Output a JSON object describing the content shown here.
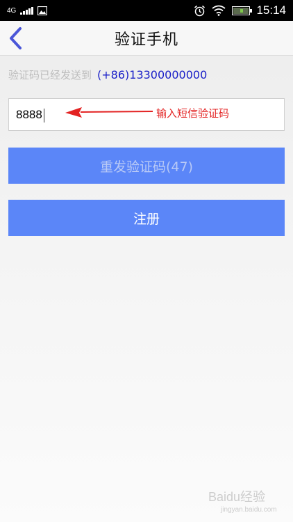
{
  "status_bar": {
    "network": "4G",
    "time": "15:14",
    "icons": [
      "signal-icon",
      "image-icon",
      "alarm-icon",
      "wifi-icon",
      "battery-icon"
    ]
  },
  "header": {
    "title": "验证手机",
    "back_icon": "chevron-left-icon"
  },
  "info": {
    "label": "验证码已经发送到",
    "phone": "(+86)13300000000"
  },
  "code_input": {
    "value": "8888"
  },
  "annotation": {
    "text": "输入短信验证码"
  },
  "buttons": {
    "resend_label": "重发验证码(47)",
    "register_label": "注册"
  },
  "watermark": {
    "text": "Baidu经验",
    "sub": "jingyan.baidu.com"
  },
  "colors": {
    "accent": "#5b86f8",
    "phone": "#1a20c8",
    "annotation": "#e32222",
    "back_arrow": "#4a56d8"
  }
}
